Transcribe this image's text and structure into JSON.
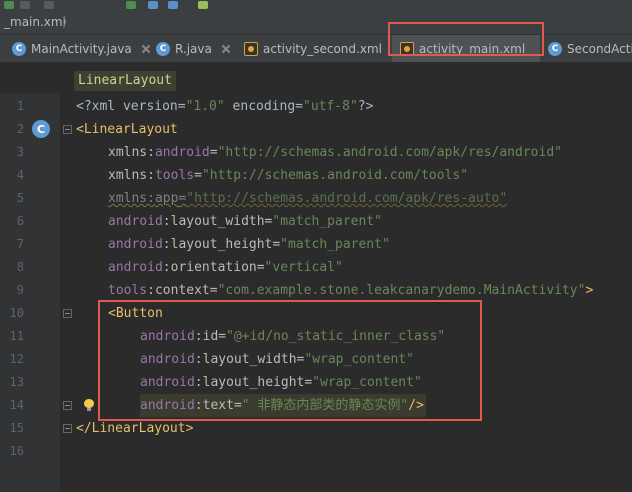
{
  "breadcrumb": {
    "file": "_main.xml"
  },
  "tabs": [
    {
      "label": "MainActivity.java",
      "icon": "class-c-icon",
      "icon_letter": "C",
      "active": false
    },
    {
      "label": "R.java",
      "icon": "class-c-icon",
      "icon_letter": "C",
      "active": false
    },
    {
      "label": "activity_second.xml",
      "icon": "xml-layout-icon",
      "active": false
    },
    {
      "label": "activity_main.xml",
      "icon": "xml-layout-icon",
      "active": true
    },
    {
      "label": "SecondActiv",
      "icon": "class-c-icon",
      "icon_letter": "C",
      "active": false
    }
  ],
  "tag_breadcrumb": "LinearLayout",
  "editor": {
    "line_numbers": [
      "1",
      "2",
      "3",
      "4",
      "5",
      "6",
      "7",
      "8",
      "9",
      "10",
      "11",
      "12",
      "13",
      "14",
      "15",
      "16"
    ],
    "lines": {
      "l1": {
        "a": "<?xml version=",
        "b": "\"1.0\"",
        "c": " encoding=",
        "d": "\"utf-8\"",
        "e": "?>"
      },
      "l2": {
        "a": "<",
        "b": "LinearLayout"
      },
      "l3": {
        "ns": "xmlns:",
        "attr": "android",
        "eq": "=",
        "val": "\"http://schemas.android.com/apk/res/android\""
      },
      "l4": {
        "ns": "xmlns:",
        "attr": "tools",
        "eq": "=",
        "val": "\"http://schemas.android.com/tools\""
      },
      "l5": {
        "ns": "xmlns:",
        "attr": "app",
        "eq": "=",
        "val": "\"http://schemas.android.com/apk/res-auto\""
      },
      "l6": {
        "ns": "android",
        "attr": ":layout_width",
        "eq": "=",
        "val": "\"match_parent\""
      },
      "l7": {
        "ns": "android",
        "attr": ":layout_height",
        "eq": "=",
        "val": "\"match_parent\""
      },
      "l8": {
        "ns": "android",
        "attr": ":orientation",
        "eq": "=",
        "val": "\"vertical\""
      },
      "l9": {
        "ns": "tools",
        "attr": ":context",
        "eq": "=",
        "val": "\"com.example.stone.leakcanarydemo.MainActivity\"",
        "end": ">"
      },
      "l10": {
        "a": "<",
        "b": "Button"
      },
      "l11": {
        "ns": "android",
        "attr": ":id",
        "eq": "=",
        "val": "\"@+id/no_static_inner_class\""
      },
      "l12": {
        "ns": "android",
        "attr": ":layout_width",
        "eq": "=",
        "val": "\"wrap_content\""
      },
      "l13": {
        "ns": "android",
        "attr": ":layout_height",
        "eq": "=",
        "val": "\"wrap_content\""
      },
      "l14": {
        "ns": "android",
        "attr": ":text",
        "eq": "=",
        "val": "\" 非静态内部类的静态实例\"",
        "end": "/>"
      },
      "l15": {
        "a": "</",
        "b": "LinearLayout",
        "c": ">"
      }
    }
  },
  "colors": {
    "tag": "#e8bf6a",
    "namespace": "#9876aa",
    "attribute": "#bababa",
    "string": "#6a8759",
    "annotation_box": "#e05a4d"
  }
}
